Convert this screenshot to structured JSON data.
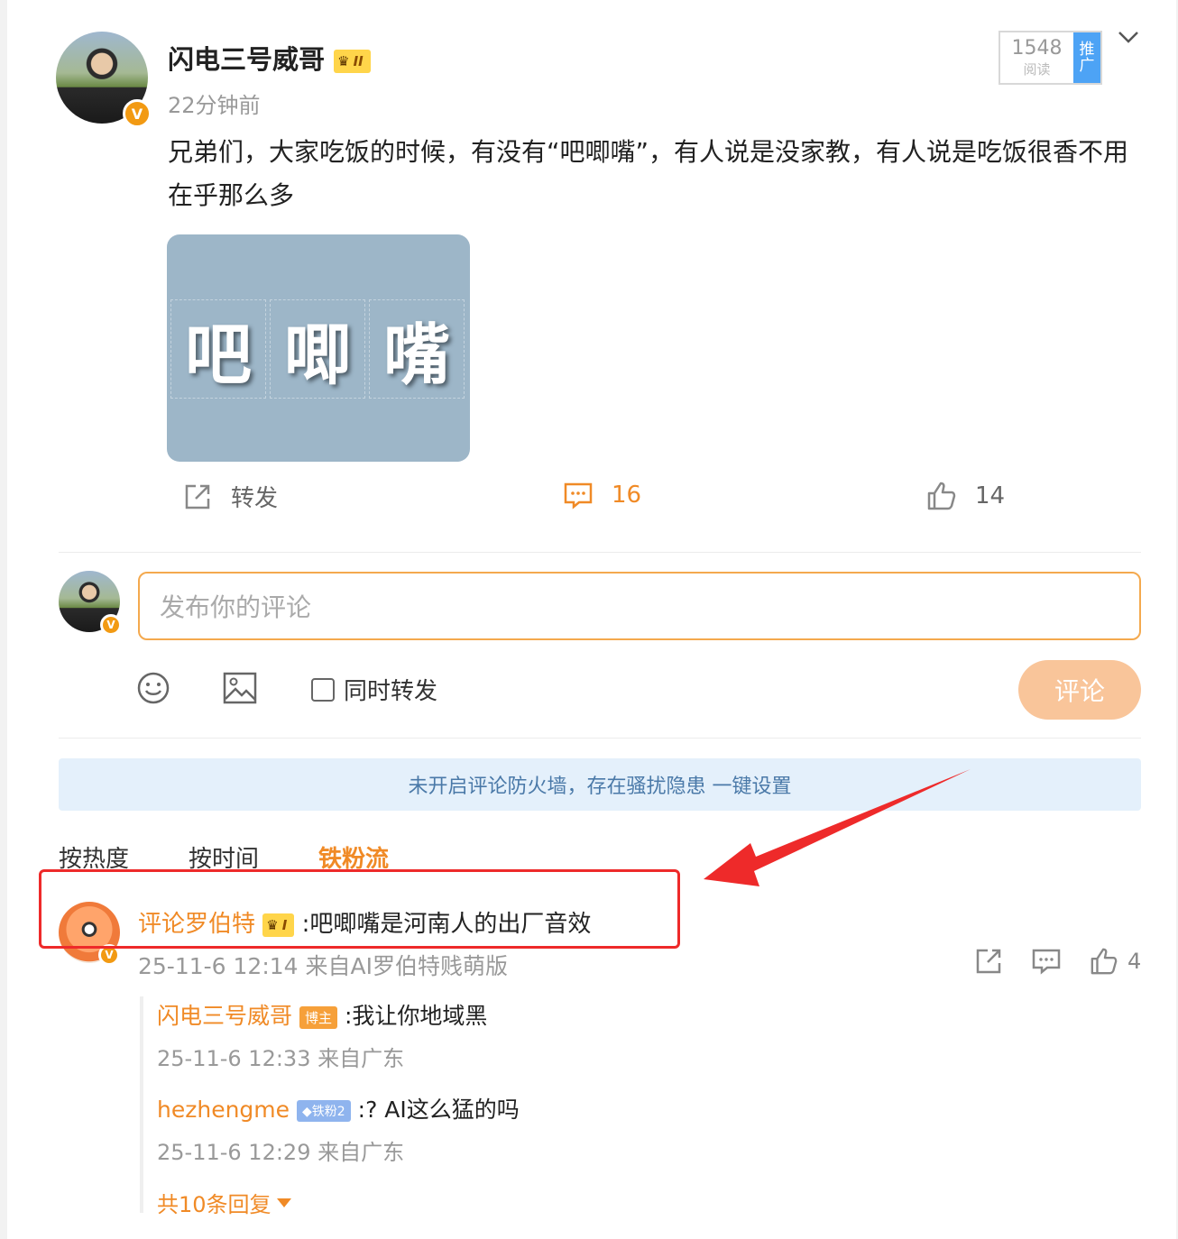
{
  "post": {
    "author": "闪电三号威哥",
    "level_badge": "II",
    "time": "22分钟前",
    "read_count": "1548",
    "read_label": "阅读",
    "promote_label": "推广",
    "text": "兄弟们，大家吃饭的时候，有没有“吧唧嘴”，有人说是没家教，有人说是吃饭很香不用在乎那么多",
    "image_chars": [
      "吧",
      "唧",
      "嘴"
    ],
    "actions": {
      "forward_label": "转发",
      "comment_count": "16",
      "like_count": "14"
    }
  },
  "composer": {
    "placeholder": "发布你的评论",
    "also_forward_label": "同时转发",
    "submit_label": "评论"
  },
  "banner": "未开启评论防火墙，存在骚扰隐患 一键设置",
  "sort_tabs": [
    "按热度",
    "按时间",
    "铁粉流"
  ],
  "comment": {
    "author": "评论罗伯特",
    "level_badge": "I",
    "text": ":吧唧嘴是河南人的出厂音效",
    "meta": "25-11-6 12:14 来自AI罗伯特贱萌版",
    "like_count": "4",
    "replies": [
      {
        "author": "闪电三号威哥",
        "tag": "博主",
        "text": ":我让你地域黑",
        "meta": "25-11-6 12:33 来自广东"
      },
      {
        "author": "hezhengme",
        "tag": "铁粉2",
        "text": ":?  AI这么猛的吗",
        "meta": "25-11-6 12:29 来自广东"
      }
    ],
    "more_replies": "共10条回复"
  },
  "colors": {
    "accent": "#f08a26",
    "input_border": "#f4a94e",
    "submit_bg": "#f9c59a",
    "banner_bg": "#e4f0fb",
    "banner_text": "#4a79a8",
    "highlight_box": "#ee2a2a",
    "arrow": "#ee2a2a"
  }
}
